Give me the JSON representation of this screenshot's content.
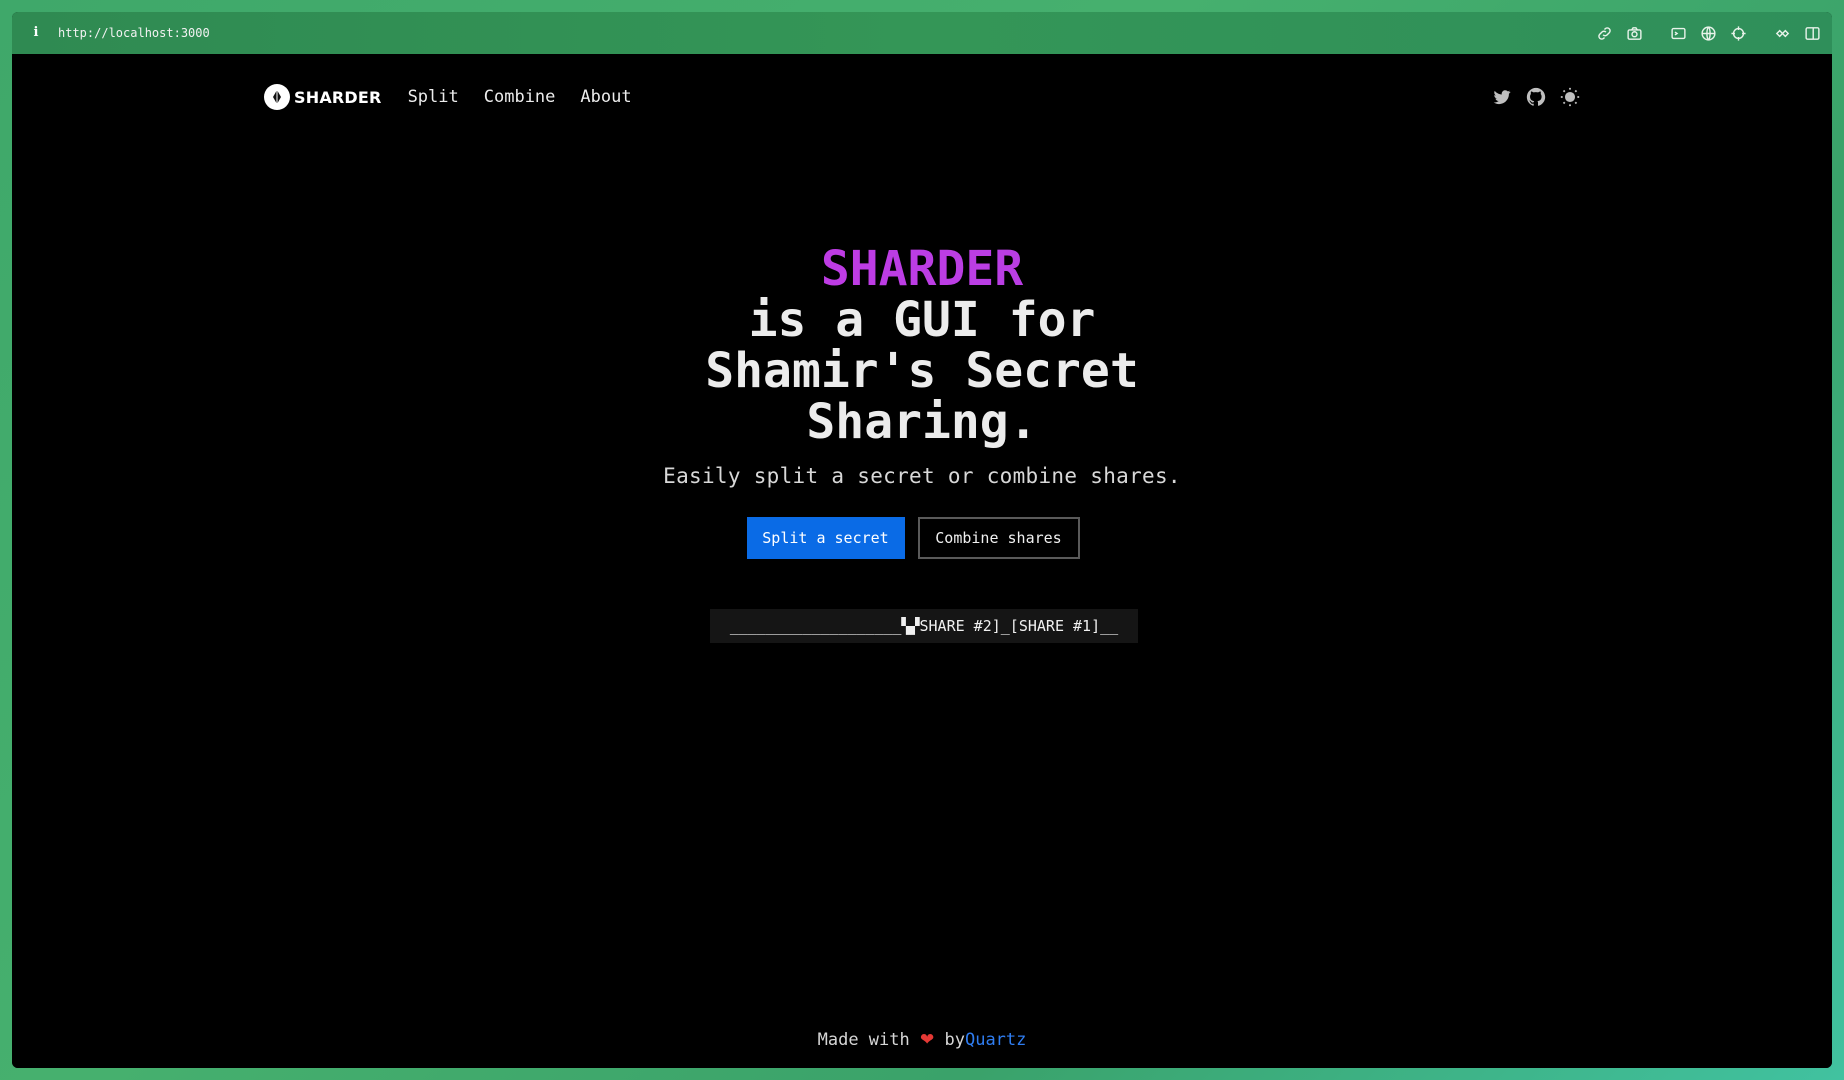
{
  "browser": {
    "url": "http://localhost:3000",
    "toolbar_icons": [
      "link-icon",
      "camera-icon",
      "terminal-icon",
      "globe-icon",
      "crosshair-icon",
      "extensions-icon",
      "sidebar-icon"
    ]
  },
  "nav": {
    "logo_text": "SHARDER",
    "links": [
      "Split",
      "Combine",
      "About"
    ],
    "right_icons": [
      "twitter-icon",
      "github-icon",
      "theme-toggle-icon"
    ]
  },
  "hero": {
    "brand": "SHARDER",
    "line2": "is a GUI for",
    "line3": "Shamir's Secret",
    "line4": "Sharing.",
    "subtitle": "Easily split a secret or combine shares."
  },
  "actions": {
    "primary": "Split a secret",
    "secondary": "Combine shares"
  },
  "ticker": {
    "left": "___________________",
    "glitch": "▚▞",
    "right": "SHARE #2]_[SHARE #1]__"
  },
  "footer": {
    "prefix": "Made with",
    "heart": "❤",
    "by": "by",
    "author": "Quartz"
  },
  "colors": {
    "brand_gradient_start": "#d030e8",
    "brand_gradient_end": "#a84ae0",
    "primary_button": "#0a6be6",
    "link": "#2f7df1",
    "background": "#000000"
  }
}
